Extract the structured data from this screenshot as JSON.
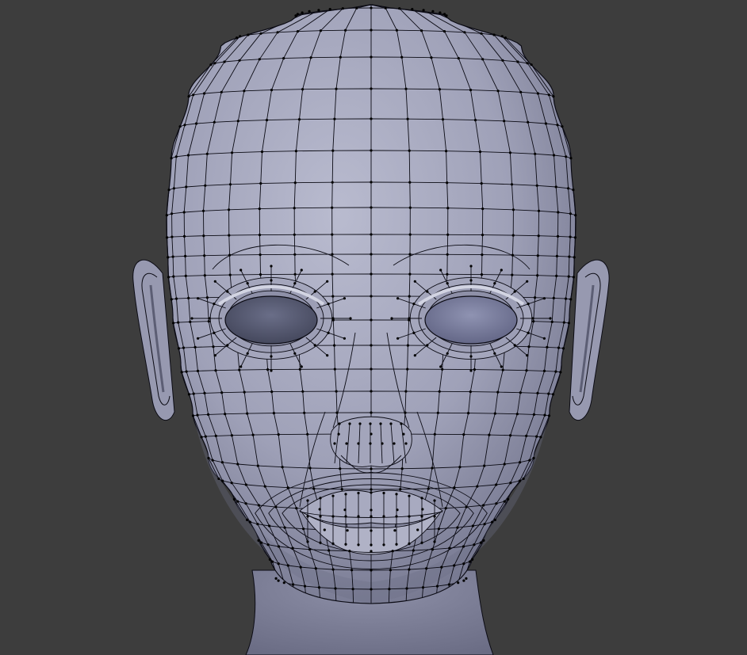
{
  "viewport": {
    "background": "#3d3d3d",
    "mesh_color": "#9a9cb3",
    "mesh_highlight": "#b6b8cc",
    "mesh_shadow": "#5f6178",
    "wire_color": "#0b0b14",
    "vertex_color": "#000000",
    "eye_socket_color": "#4d5166"
  },
  "model": {
    "name": "head-mesh",
    "display": "wireframe-on-shaded"
  }
}
